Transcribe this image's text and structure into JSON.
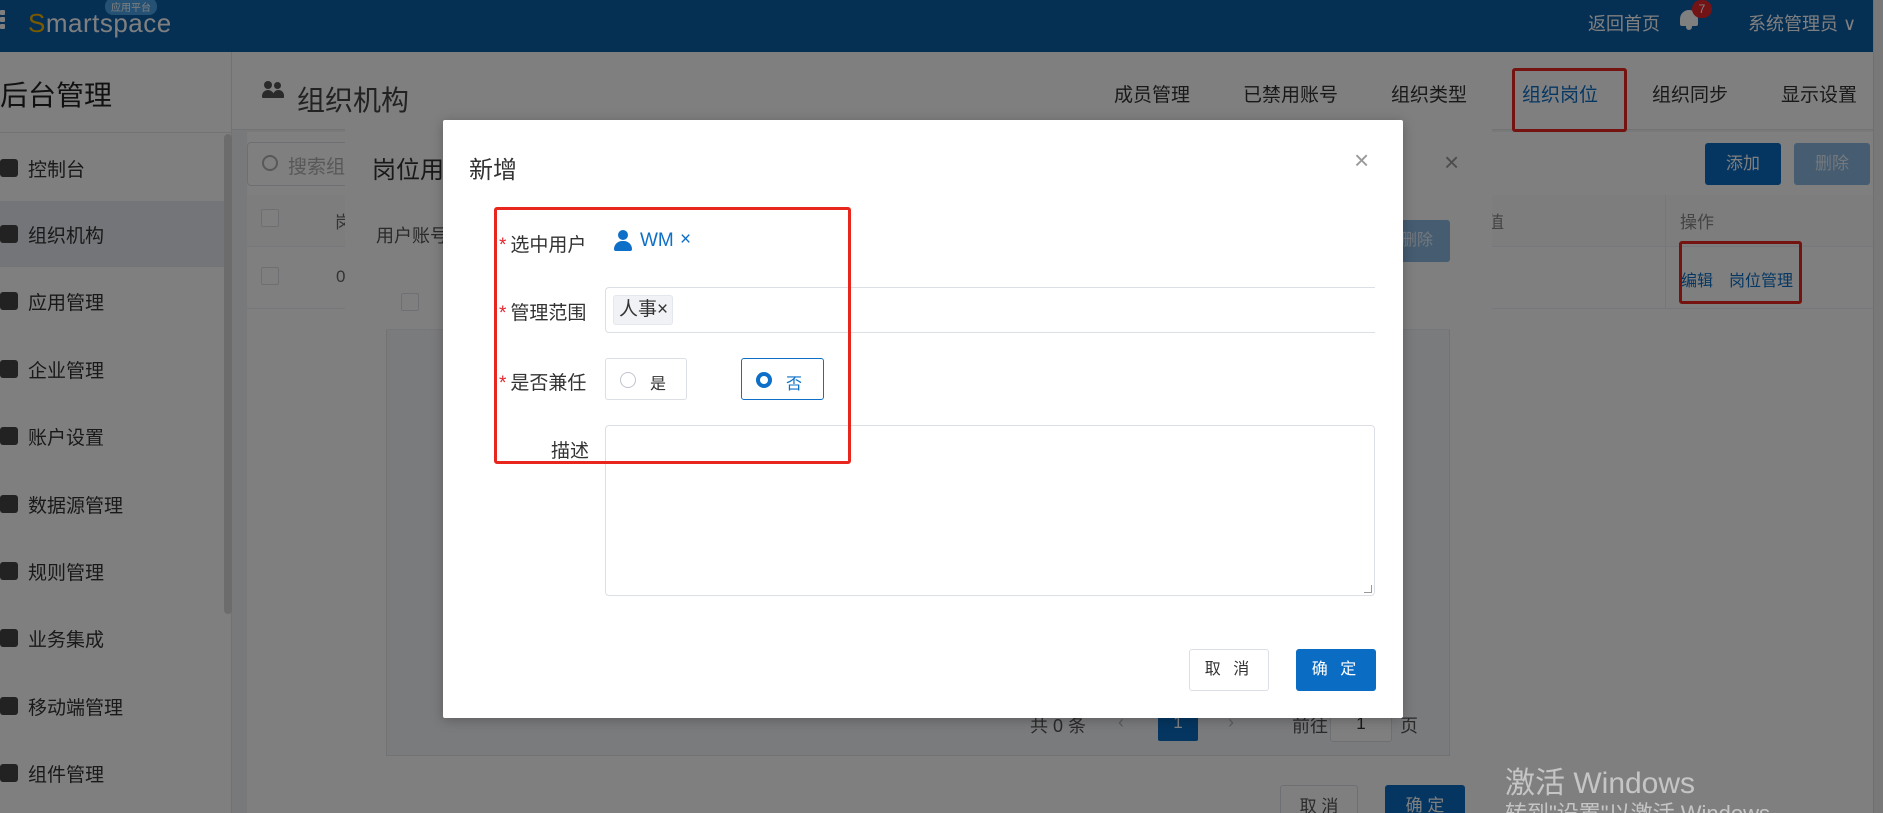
{
  "topbar": {
    "logo_prefix": "S",
    "logo_rest": "martspace",
    "logo_badge": "应用平台",
    "home_link": "返回首页",
    "notification_count": "7",
    "user_menu": "系统管理员",
    "user_menu_arrow": "∨",
    "brand_color": "#0d5fa8"
  },
  "sidebar": {
    "title": "后台管理",
    "items": [
      {
        "label": "控制台",
        "icon": "dashboard-icon"
      },
      {
        "label": "组织机构",
        "icon": "org-icon"
      },
      {
        "label": "应用管理",
        "icon": "app-icon"
      },
      {
        "label": "企业管理",
        "icon": "enterprise-icon"
      },
      {
        "label": "账户设置",
        "icon": "account-icon"
      },
      {
        "label": "数据源管理",
        "icon": "datasource-icon"
      },
      {
        "label": "规则管理",
        "icon": "rule-icon"
      },
      {
        "label": "业务集成",
        "icon": "integration-icon"
      },
      {
        "label": "移动端管理",
        "icon": "mobile-icon"
      },
      {
        "label": "组件管理",
        "icon": "component-icon"
      }
    ]
  },
  "header": {
    "title": "组织机构",
    "tabs": [
      "成员管理",
      "已禁用账号",
      "组织类型",
      "组织岗位",
      "组织同步",
      "显示设置"
    ],
    "active_tab": "组织岗位"
  },
  "list": {
    "search_placeholder": "搜索组",
    "add_button": "添加",
    "delete_button": "删除",
    "column_value": "值",
    "column_ops": "操作",
    "col_partial": "岗",
    "row_partial": "0",
    "row_ops": [
      "编辑",
      "岗位管理"
    ]
  },
  "under_dialog": {
    "title": "岗位用",
    "user_account_label": "用户账号",
    "delete_button": "删除",
    "pager": {
      "total": "共 0 条",
      "prev": "‹",
      "page": "1",
      "next": "›",
      "goto": "前往",
      "goto_value": "1",
      "unit": "页"
    },
    "cancel": "取 消",
    "ok": "确 定"
  },
  "dialog": {
    "title": "新增",
    "close": "×",
    "required_mark": "*",
    "fields": {
      "user_label": "选中用户",
      "user_value": "WM",
      "user_remove": "×",
      "scope_label": "管理范围",
      "scope_tag": "人事",
      "scope_tag_remove": "×",
      "concurrent_label": "是否兼任",
      "concurrent_options": [
        "是",
        "否"
      ],
      "concurrent_selected": "否",
      "desc_label": "描述",
      "desc_value": ""
    },
    "cancel": "取 消",
    "ok": "确 定",
    "accent_color": "#0b6cc3",
    "highlight_color": "#e8261e"
  },
  "watermark": {
    "line1": "激活 Windows",
    "line2": "转到\"设置\"以激活 Windows。"
  }
}
